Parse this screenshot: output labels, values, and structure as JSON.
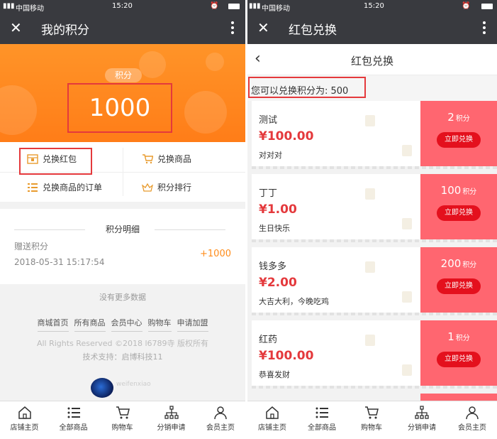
{
  "left": {
    "status": {
      "carrier": "中国移动",
      "time": "15:20"
    },
    "navbar": {
      "close": "✕",
      "title": "我的积分"
    },
    "points": {
      "label": "积分",
      "value": "1000"
    },
    "menu": {
      "redeem_packet": "兑换红包",
      "redeem_goods": "兑换商品",
      "redeem_orders": "兑换商品的订单",
      "points_rank": "积分排行"
    },
    "detail": {
      "title": "积分明细",
      "type": "赠送积分",
      "date": "2018-05-31 15:17:54",
      "amount": "+1000"
    },
    "no_more": "没有更多数据",
    "links": [
      "商城首页",
      "所有商品",
      "会员中心",
      "购物车",
      "申请加盟"
    ],
    "copyright": "All Rights Reserved ©2018 l6789寺 版权所有",
    "tech": "技术支持：启博科技11",
    "logo_text": "weifenxiao"
  },
  "right": {
    "status": {
      "carrier": "中国移动",
      "time": "15:20"
    },
    "navbar": {
      "close": "✕",
      "title": "红包兑换"
    },
    "subhead": {
      "back": "‹",
      "title": "红包兑换"
    },
    "available": "您可以兑换积分为: 500",
    "cards": [
      {
        "name": "测试",
        "price": "¥100.00",
        "desc": "对对对",
        "points": "2",
        "unit": "积分",
        "button": "立即兑换"
      },
      {
        "name": "丁丁",
        "price": "¥1.00",
        "desc": "生日快乐",
        "points": "100",
        "unit": "积分",
        "button": "立即兑换"
      },
      {
        "name": "钱多多",
        "price": "¥2.00",
        "desc": "大吉大利，今晚吃鸡",
        "points": "200",
        "unit": "积分",
        "button": "立即兑换"
      },
      {
        "name": "红药",
        "price": "¥100.00",
        "desc": "恭喜发财",
        "points": "1",
        "unit": "积分",
        "button": "立即兑换"
      }
    ]
  },
  "tabbar": [
    "店铺主页",
    "全部商品",
    "购物车",
    "分销申请",
    "会员主页"
  ],
  "colors": {
    "nav": "#393a3f",
    "orange": "#ff8a22",
    "red": "#e4393c",
    "card_pink": "#ff6670"
  }
}
